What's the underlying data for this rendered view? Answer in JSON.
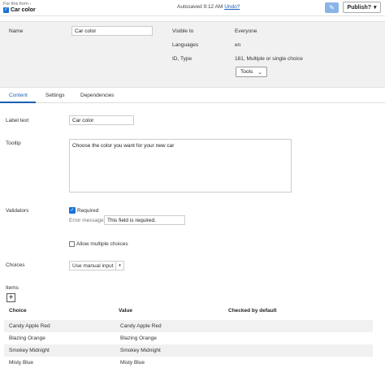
{
  "header": {
    "breadcrumb": "For this form",
    "breadcrumb_arrow": "›",
    "title": "Car color",
    "autosave": "Autosaved 9:12 AM",
    "undo": "Undo?",
    "publish_label": "Publish?",
    "publish_caret": "▾"
  },
  "info": {
    "name_label": "Name",
    "name_value": "Car color",
    "visible_to_label": "Visible to",
    "visible_to_value": "Everyone",
    "languages_label": "Languages",
    "languages_value": "en",
    "id_type_label": "ID, Type",
    "id_type_value": "181, Multiple or single choice",
    "tools_label": "Tools",
    "tools_caret": "⌄"
  },
  "tabs": [
    {
      "label": "Content",
      "active": true
    },
    {
      "label": "Settings",
      "active": false
    },
    {
      "label": "Dependencies",
      "active": false
    }
  ],
  "content": {
    "label_text_label": "Label text",
    "label_text_value": "Car color",
    "tooltip_label": "Tooltip",
    "tooltip_value": "Choose the color you want for your new car",
    "validators_label": "Validators",
    "required_label": "Required",
    "error_message_label": "Error message",
    "error_message_value": "This field is required.",
    "allow_multiple_label": "Allow multiple choices",
    "choices_label": "Choices",
    "choices_select_value": "Use manual input",
    "choices_select_caret": "▾",
    "items_label": "Items",
    "add_item": "+"
  },
  "table": {
    "headers": {
      "choice": "Choice",
      "value": "Value",
      "checked": "Checked by default"
    },
    "rows": [
      {
        "choice": "Candy Apple Red",
        "value": "Candy Apple Red"
      },
      {
        "choice": "Blazing Orange",
        "value": "Blazing Orange"
      },
      {
        "choice": "Smokey Midnight",
        "value": "Smokey Midnight"
      },
      {
        "choice": "Misty Blue",
        "value": "Misty Blue"
      }
    ]
  },
  "colors": {
    "accent": "#1a5fb4",
    "checkbox": "#1a73d9",
    "panel": "#f1f1f1"
  },
  "icons": {
    "edit": "pencil-icon",
    "check": "checkmark-icon"
  }
}
